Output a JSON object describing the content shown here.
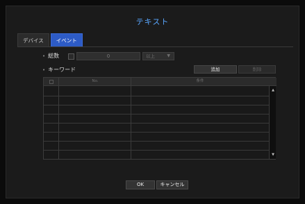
{
  "dialog": {
    "title": "テキスト"
  },
  "tabs": [
    {
      "label": "デバイス",
      "active": false
    },
    {
      "label": "イベント",
      "active": true
    }
  ],
  "total": {
    "label": "総数",
    "checked": false,
    "value": "0",
    "condition_selected": "以上"
  },
  "keyword": {
    "label": "キーワード",
    "add_label": "追加",
    "delete_label": "削除"
  },
  "table": {
    "columns": [
      "No.",
      "条件"
    ],
    "rows": []
  },
  "footer": {
    "ok_label": "OK",
    "cancel_label": "キャンセル"
  },
  "colors": {
    "accent": "#2d5bc6",
    "title": "#5aa7ff"
  },
  "icons": {
    "scroll_up": "scroll-up-arrow-icon",
    "scroll_down": "scroll-down-arrow-icon",
    "dropdown": "dropdown-arrow-icon"
  }
}
